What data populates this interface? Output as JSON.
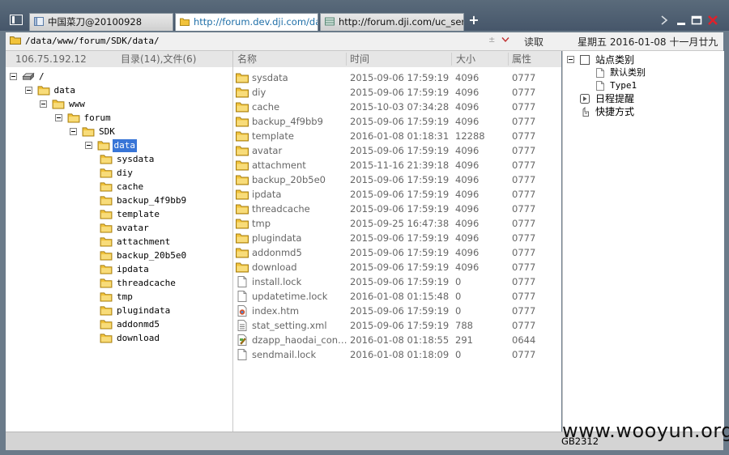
{
  "tabs": [
    {
      "label": "中国菜刀@20100928",
      "type": "app"
    },
    {
      "label": "http://forum.dev.dji.com/data...",
      "type": "link",
      "active": true
    },
    {
      "label": "http://forum.dji.com/uc_serve...",
      "type": "link"
    }
  ],
  "address": {
    "path": "/data/www/forum/SDK/data/",
    "combo_marker": "±"
  },
  "read_button": "读取",
  "date_display": "星期五 2016-01-08 十一月廿九",
  "left_header": {
    "ip": "106.75.192.12",
    "dir_count": "目录(14),文件(6)"
  },
  "columns": {
    "name": "名称",
    "time": "时间",
    "size": "大小",
    "attr": "属性"
  },
  "tree": [
    {
      "label": "/",
      "depth": 0,
      "icon": "drive-icon",
      "expander": true
    },
    {
      "label": "data",
      "depth": 1,
      "icon": "folder-icon",
      "expander": true
    },
    {
      "label": "www",
      "depth": 2,
      "icon": "folder-icon",
      "expander": true
    },
    {
      "label": "forum",
      "depth": 3,
      "icon": "folder-icon",
      "expander": true
    },
    {
      "label": "SDK",
      "depth": 4,
      "icon": "folder-icon",
      "expander": true
    },
    {
      "label": "data",
      "depth": 5,
      "icon": "folder-open-icon",
      "expander": true,
      "selected": true
    },
    {
      "label": "sysdata",
      "depth": 6,
      "icon": "folder-icon"
    },
    {
      "label": "diy",
      "depth": 6,
      "icon": "folder-icon"
    },
    {
      "label": "cache",
      "depth": 6,
      "icon": "folder-icon"
    },
    {
      "label": "backup_4f9bb9",
      "depth": 6,
      "icon": "folder-icon"
    },
    {
      "label": "template",
      "depth": 6,
      "icon": "folder-icon"
    },
    {
      "label": "avatar",
      "depth": 6,
      "icon": "folder-icon"
    },
    {
      "label": "attachment",
      "depth": 6,
      "icon": "folder-icon"
    },
    {
      "label": "backup_20b5e0",
      "depth": 6,
      "icon": "folder-icon"
    },
    {
      "label": "ipdata",
      "depth": 6,
      "icon": "folder-icon"
    },
    {
      "label": "threadcache",
      "depth": 6,
      "icon": "folder-icon"
    },
    {
      "label": "tmp",
      "depth": 6,
      "icon": "folder-icon"
    },
    {
      "label": "plugindata",
      "depth": 6,
      "icon": "folder-icon"
    },
    {
      "label": "addonmd5",
      "depth": 6,
      "icon": "folder-icon"
    },
    {
      "label": "download",
      "depth": 6,
      "icon": "folder-icon"
    }
  ],
  "files": [
    {
      "name": "sysdata",
      "time": "2015-09-06 17:59:19",
      "size": "4096",
      "attr": "0777",
      "icon": "folder-icon"
    },
    {
      "name": "diy",
      "time": "2015-09-06 17:59:19",
      "size": "4096",
      "attr": "0777",
      "icon": "folder-icon"
    },
    {
      "name": "cache",
      "time": "2015-10-03 07:34:28",
      "size": "4096",
      "attr": "0777",
      "icon": "folder-icon"
    },
    {
      "name": "backup_4f9bb9",
      "time": "2015-09-06 17:59:19",
      "size": "4096",
      "attr": "0777",
      "icon": "folder-icon"
    },
    {
      "name": "template",
      "time": "2016-01-08 01:18:31",
      "size": "12288",
      "attr": "0777",
      "icon": "folder-icon"
    },
    {
      "name": "avatar",
      "time": "2015-09-06 17:59:19",
      "size": "4096",
      "attr": "0777",
      "icon": "folder-icon"
    },
    {
      "name": "attachment",
      "time": "2015-11-16 21:39:18",
      "size": "4096",
      "attr": "0777",
      "icon": "folder-icon"
    },
    {
      "name": "backup_20b5e0",
      "time": "2015-09-06 17:59:19",
      "size": "4096",
      "attr": "0777",
      "icon": "folder-icon"
    },
    {
      "name": "ipdata",
      "time": "2015-09-06 17:59:19",
      "size": "4096",
      "attr": "0777",
      "icon": "folder-icon"
    },
    {
      "name": "threadcache",
      "time": "2015-09-06 17:59:19",
      "size": "4096",
      "attr": "0777",
      "icon": "folder-icon"
    },
    {
      "name": "tmp",
      "time": "2015-09-25 16:47:38",
      "size": "4096",
      "attr": "0777",
      "icon": "folder-icon"
    },
    {
      "name": "plugindata",
      "time": "2015-09-06 17:59:19",
      "size": "4096",
      "attr": "0777",
      "icon": "folder-icon"
    },
    {
      "name": "addonmd5",
      "time": "2015-09-06 17:59:19",
      "size": "4096",
      "attr": "0777",
      "icon": "folder-icon"
    },
    {
      "name": "download",
      "time": "2015-09-06 17:59:19",
      "size": "4096",
      "attr": "0777",
      "icon": "folder-icon"
    },
    {
      "name": "install.lock",
      "time": "2015-09-06 17:59:19",
      "size": "0",
      "attr": "0777",
      "icon": "file-icon"
    },
    {
      "name": "updatetime.lock",
      "time": "2016-01-08 01:15:48",
      "size": "0",
      "attr": "0777",
      "icon": "file-icon"
    },
    {
      "name": "index.htm",
      "time": "2015-09-06 17:59:19",
      "size": "0",
      "attr": "0777",
      "icon": "html-file-icon"
    },
    {
      "name": "stat_setting.xml",
      "time": "2015-09-06 17:59:19",
      "size": "788",
      "attr": "0777",
      "icon": "xml-file-icon"
    },
    {
      "name": "dzapp_haodai_config....",
      "time": "2016-01-08 01:18:55",
      "size": "291",
      "attr": "0644",
      "icon": "php-file-icon"
    },
    {
      "name": "sendmail.lock",
      "time": "2016-01-08 01:18:09",
      "size": "0",
      "attr": "0777",
      "icon": "file-icon"
    }
  ],
  "side_tree": [
    {
      "label": "站点类别",
      "depth": 0,
      "icon": "category-icon",
      "expander": true
    },
    {
      "label": "默认类别",
      "depth": 1,
      "icon": "page-icon"
    },
    {
      "label": "Type1",
      "depth": 1,
      "icon": "page-icon"
    },
    {
      "label": "日程提醒",
      "depth": 0,
      "icon": "schedule-icon"
    },
    {
      "label": "快捷方式",
      "depth": 0,
      "icon": "shortcut-icon"
    }
  ],
  "status": {
    "encoding": "GB2312"
  },
  "watermark": "www.wooyun.org",
  "colors": {
    "selection": "#3875d7",
    "folder": "#f2c33b",
    "link": "#1f6fa8"
  }
}
